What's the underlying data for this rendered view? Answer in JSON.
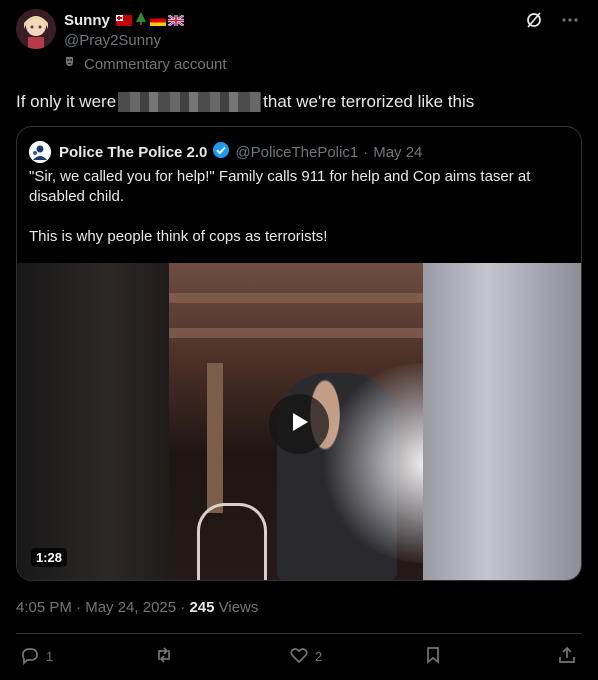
{
  "author": {
    "name": "Sunny",
    "handle": "@Pray2Sunny",
    "label": "Commentary account",
    "flag_icons": [
      "tonga-flag-icon",
      "christmas-tree-icon",
      "germany-flag-icon",
      "uk-flag-icon"
    ]
  },
  "post": {
    "text_before": "If only it were",
    "text_after": "that we're terrorized like this",
    "time": "4:05 PM",
    "date": "May 24, 2025",
    "views_count": "245",
    "views_label": "Views",
    "separator": "·"
  },
  "quote": {
    "name": "Police The Police 2.0",
    "handle": "@PoliceThePolic1",
    "date": "May 24",
    "separator": "·",
    "body_line1": "\"Sir, we called you for help!\" Family calls 911 for help and Cop aims taser at disabled child.",
    "body_line2": "This is why people think of cops as terrorists!",
    "video_duration": "1:28"
  },
  "actions": {
    "reply_count": "1",
    "repost_count": "",
    "like_count": "2"
  },
  "colors": {
    "background": "#000000",
    "text_primary": "#e7e9ea",
    "text_secondary": "#71767b",
    "border": "#2f3336",
    "verified": "#1d9bf0"
  }
}
